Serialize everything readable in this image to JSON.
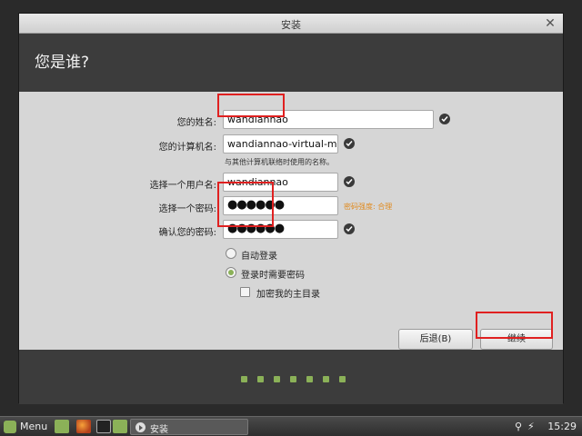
{
  "window": {
    "title": "安装"
  },
  "header": {
    "title": "您是谁?"
  },
  "form": {
    "name_label": "您的姓名:",
    "name_value": "wandiannao",
    "computer_label": "您的计算机名:",
    "computer_value": "wandiannao-virtual-machir",
    "computer_hint": "与其他计算机联络时使用的名称。",
    "username_label": "选择一个用户名:",
    "username_value": "wandiannao",
    "password_label": "选择一个密码:",
    "password_value": "●●●●●●",
    "password_strength": "密码强度: 合理",
    "confirm_label": "确认您的密码:",
    "confirm_value": "●●●●●●"
  },
  "options": {
    "auto_login": "自动登录",
    "require_password": "登录时需要密码",
    "encrypt_home": "加密我的主目录",
    "selected": "require_password",
    "encrypt_checked": false
  },
  "buttons": {
    "back": "后退(B)",
    "continue": "继续"
  },
  "progress": {
    "steps": 7,
    "accent": "#8bb158"
  },
  "taskbar": {
    "menu_label": "Menu",
    "task_label": "安装",
    "clock": "15:29"
  }
}
